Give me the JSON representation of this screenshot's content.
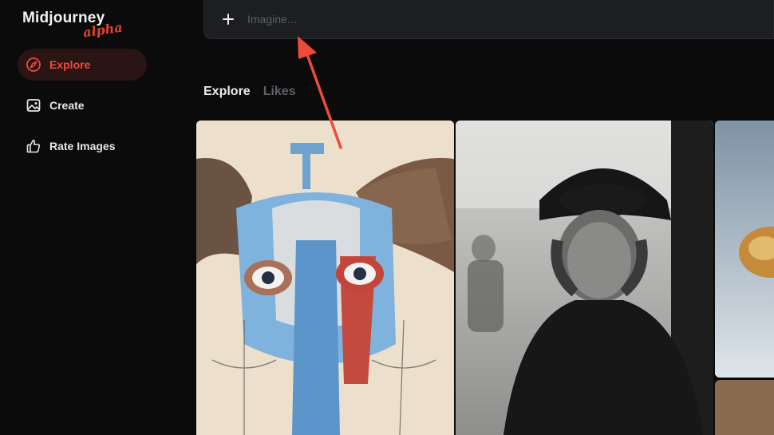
{
  "brand": {
    "name": "Midjourney",
    "tag": "alpha",
    "accent": "#e8412d"
  },
  "sidebar": {
    "items": [
      {
        "label": "Explore",
        "icon": "compass-icon",
        "active": true
      },
      {
        "label": "Create",
        "icon": "image-icon",
        "active": false
      },
      {
        "label": "Rate Images",
        "icon": "thumbs-up-icon",
        "active": false
      }
    ]
  },
  "prompt": {
    "placeholder": "Imagine...",
    "add_icon": "plus-icon"
  },
  "tabs": [
    {
      "label": "Explore",
      "active": true
    },
    {
      "label": "Likes",
      "active": false
    }
  ],
  "gallery": {
    "images": [
      {
        "subject": "abstract blue elephant painting"
      },
      {
        "subject": "black and white portrait of an elderly woman in a hat"
      },
      {
        "subject": "blurred photo"
      },
      {
        "subject": "brown photo"
      }
    ]
  },
  "annotation": {
    "type": "arrow",
    "color": "#ee4b3a",
    "points_to": "prompt-input"
  }
}
